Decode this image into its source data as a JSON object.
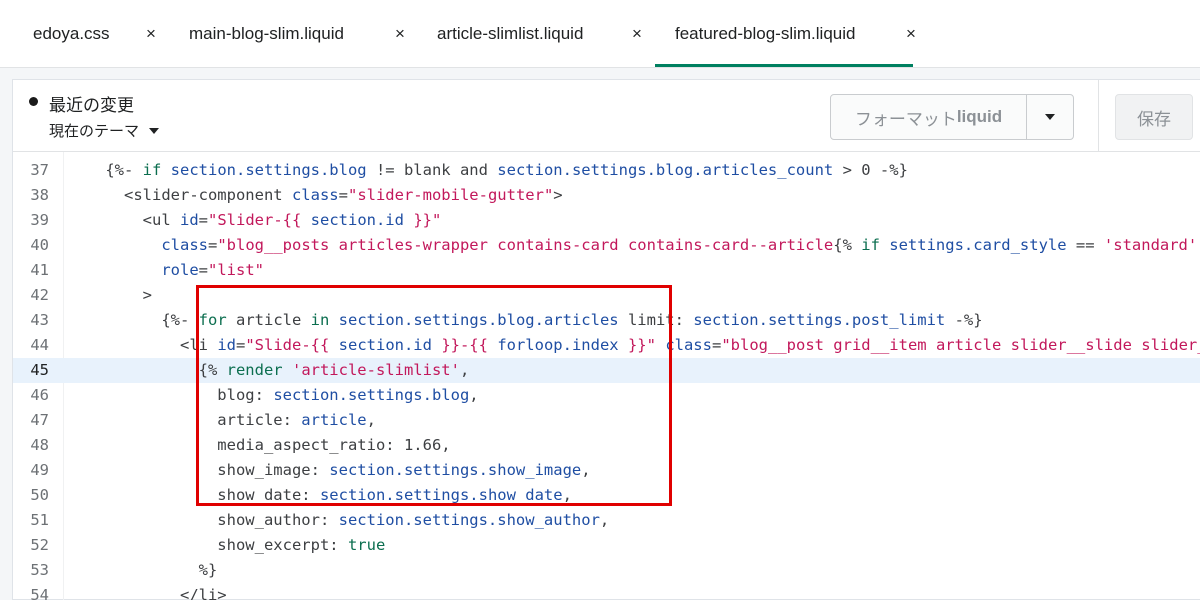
{
  "tabs": [
    {
      "label": "edoya.css",
      "close": "×"
    },
    {
      "label": "main-blog-slim.liquid",
      "close": "×"
    },
    {
      "label": "article-slimlist.liquid",
      "close": "×"
    },
    {
      "label": "featured-blog-slim.liquid",
      "close": "×",
      "active": true
    }
  ],
  "toolbar": {
    "recent_changes": "最近の変更",
    "theme_select": "現在のテーマ",
    "format_prefix": "フォーマット",
    "format_lang": "liquid",
    "save_label": "保存"
  },
  "editor": {
    "current_line": 45,
    "lines": [
      {
        "n": "37",
        "html": "    {%- <span class=\"k\">if</span> <span class=\"p\">section.settings.blog</span> != blank and <span class=\"p\">section.settings.blog.articles_count</span> &gt; 0 -%}"
      },
      {
        "n": "38",
        "html": "      &lt;slider-component <span class=\"p\">class</span>=<span class=\"s\">\"slider-mobile-gutter\"</span>&gt;"
      },
      {
        "n": "39",
        "html": "        &lt;ul <span class=\"p\">id</span>=<span class=\"s\">\"Slider-{{ </span><span class=\"p\">section.id</span><span class=\"s\"> }}\"</span>"
      },
      {
        "n": "40",
        "html": "          <span class=\"p\">class</span>=<span class=\"s\">\"blog__posts articles-wrapper contains-card contains-card--article</span>{% <span class=\"k\">if</span> <span class=\"p\">settings.card_style</span> == <span class=\"s\">'standard'</span> %"
      },
      {
        "n": "41",
        "html": "          <span class=\"p\">role</span>=<span class=\"s\">\"list\"</span>"
      },
      {
        "n": "42",
        "html": "        &gt;"
      },
      {
        "n": "43",
        "html": "          {%- <span class=\"k\">for</span> article <span class=\"k\">in</span> <span class=\"p\">section.settings.blog.articles</span> limit: <span class=\"p\">section.settings.post_limit</span> -%}"
      },
      {
        "n": "44",
        "html": "            &lt;li <span class=\"p\">id</span>=<span class=\"s\">\"Slide-{{ </span><span class=\"p\">section.id</span><span class=\"s\"> }}-{{ </span><span class=\"p\">forloop.index</span><span class=\"s\"> }}\"</span> <span class=\"p\">class</span>=<span class=\"s\">\"blog__post grid__item article slider__slide slider__\"</span>"
      },
      {
        "n": "45",
        "html": "              {% <span class=\"k\">render</span> <span class=\"s\">'article-slimlist'</span>,"
      },
      {
        "n": "46",
        "html": "                blog: <span class=\"p\">section.settings.blog</span>,"
      },
      {
        "n": "47",
        "html": "                article: <span class=\"p\">article</span>,"
      },
      {
        "n": "48",
        "html": "                media_aspect_ratio: 1.66,"
      },
      {
        "n": "49",
        "html": "                show_image: <span class=\"p\">section.settings.show_image</span>,"
      },
      {
        "n": "50",
        "html": "                show_date: <span class=\"p\">section.settings.show_date</span>,"
      },
      {
        "n": "51",
        "html": "                show_author: <span class=\"p\">section.settings.show_author</span>,"
      },
      {
        "n": "52",
        "html": "                show_excerpt: <span class=\"k\">true</span>"
      },
      {
        "n": "53",
        "html": "              %}"
      },
      {
        "n": "54",
        "html": "            &lt;/li&gt;"
      }
    ]
  }
}
